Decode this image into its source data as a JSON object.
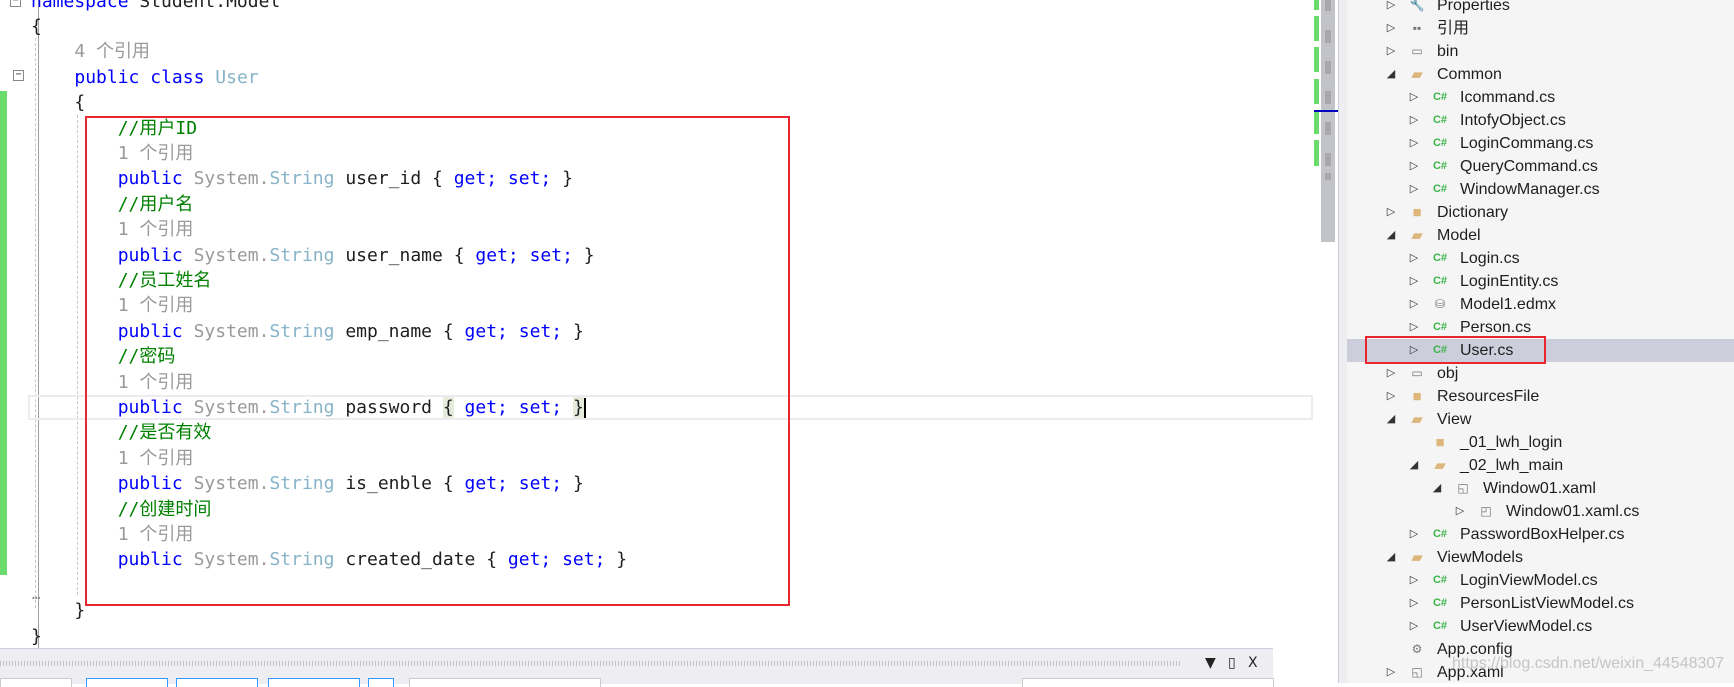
{
  "editor": {
    "lines": [
      [
        {
          "t": "namespace ",
          "k": "kw"
        },
        {
          "t": "Student.Model",
          "k": "id"
        }
      ],
      [
        {
          "t": "{",
          "k": "br"
        }
      ],
      [
        {
          "t": "    "
        },
        {
          "t": "4 个引用",
          "k": "lens"
        }
      ],
      [
        {
          "t": "    "
        },
        {
          "t": "public",
          "k": "kw"
        },
        {
          "t": " "
        },
        {
          "t": "class",
          "k": "kw"
        },
        {
          "t": " "
        },
        {
          "t": "User",
          "k": "ty"
        }
      ],
      [
        {
          "t": "    "
        },
        {
          "t": "{",
          "k": "br"
        }
      ],
      [
        {
          "t": "        "
        },
        {
          "t": "//用户ID",
          "k": "cm"
        }
      ],
      [
        {
          "t": "        "
        },
        {
          "t": "1 个引用",
          "k": "lens"
        }
      ],
      [
        {
          "t": "        "
        },
        {
          "t": "public",
          "k": "kw"
        },
        {
          "t": " "
        },
        {
          "t": "System.",
          "k": "sys"
        },
        {
          "t": "String",
          "k": "ty"
        },
        {
          "t": " "
        },
        {
          "t": "user_id",
          "k": "id"
        },
        {
          "t": " "
        },
        {
          "t": "{",
          "k": "br"
        },
        {
          "t": " "
        },
        {
          "t": "get;",
          "k": "kw"
        },
        {
          "t": " "
        },
        {
          "t": "set;",
          "k": "kw"
        },
        {
          "t": " "
        },
        {
          "t": "}",
          "k": "br"
        }
      ],
      [
        {
          "t": "        "
        },
        {
          "t": "//用户名",
          "k": "cm"
        }
      ],
      [
        {
          "t": "        "
        },
        {
          "t": "1 个引用",
          "k": "lens"
        }
      ],
      [
        {
          "t": "        "
        },
        {
          "t": "public",
          "k": "kw"
        },
        {
          "t": " "
        },
        {
          "t": "System.",
          "k": "sys"
        },
        {
          "t": "String",
          "k": "ty"
        },
        {
          "t": " "
        },
        {
          "t": "user_name",
          "k": "id"
        },
        {
          "t": " "
        },
        {
          "t": "{",
          "k": "br"
        },
        {
          "t": " "
        },
        {
          "t": "get;",
          "k": "kw"
        },
        {
          "t": " "
        },
        {
          "t": "set;",
          "k": "kw"
        },
        {
          "t": " "
        },
        {
          "t": "}",
          "k": "br"
        }
      ],
      [
        {
          "t": "        "
        },
        {
          "t": "//员工姓名",
          "k": "cm"
        }
      ],
      [
        {
          "t": "        "
        },
        {
          "t": "1 个引用",
          "k": "lens"
        }
      ],
      [
        {
          "t": "        "
        },
        {
          "t": "public",
          "k": "kw"
        },
        {
          "t": " "
        },
        {
          "t": "System.",
          "k": "sys"
        },
        {
          "t": "String",
          "k": "ty"
        },
        {
          "t": " "
        },
        {
          "t": "emp_name",
          "k": "id"
        },
        {
          "t": " "
        },
        {
          "t": "{",
          "k": "br"
        },
        {
          "t": " "
        },
        {
          "t": "get;",
          "k": "kw"
        },
        {
          "t": " "
        },
        {
          "t": "set;",
          "k": "kw"
        },
        {
          "t": " "
        },
        {
          "t": "}",
          "k": "br"
        }
      ],
      [
        {
          "t": "        "
        },
        {
          "t": "//密码",
          "k": "cm"
        }
      ],
      [
        {
          "t": "        "
        },
        {
          "t": "1 个引用",
          "k": "lens"
        }
      ],
      [
        {
          "t": "        "
        },
        {
          "t": "public",
          "k": "kw"
        },
        {
          "t": " "
        },
        {
          "t": "System.",
          "k": "sys"
        },
        {
          "t": "String",
          "k": "ty"
        },
        {
          "t": " "
        },
        {
          "t": "password",
          "k": "id"
        },
        {
          "t": " "
        },
        {
          "t": "{",
          "k": "br hl"
        },
        {
          "t": " "
        },
        {
          "t": "get;",
          "k": "kw"
        },
        {
          "t": " "
        },
        {
          "t": "set;",
          "k": "kw"
        },
        {
          "t": " "
        },
        {
          "t": "}",
          "k": "br hl"
        },
        {
          "caret": true
        }
      ],
      [
        {
          "t": "        "
        },
        {
          "t": "//是否有效",
          "k": "cm"
        }
      ],
      [
        {
          "t": "        "
        },
        {
          "t": "1 个引用",
          "k": "lens"
        }
      ],
      [
        {
          "t": "        "
        },
        {
          "t": "public",
          "k": "kw"
        },
        {
          "t": " "
        },
        {
          "t": "System.",
          "k": "sys"
        },
        {
          "t": "String",
          "k": "ty"
        },
        {
          "t": " "
        },
        {
          "t": "is_enble",
          "k": "id"
        },
        {
          "t": " "
        },
        {
          "t": "{",
          "k": "br"
        },
        {
          "t": " "
        },
        {
          "t": "get;",
          "k": "kw"
        },
        {
          "t": " "
        },
        {
          "t": "set;",
          "k": "kw"
        },
        {
          "t": " "
        },
        {
          "t": "}",
          "k": "br"
        }
      ],
      [
        {
          "t": "        "
        },
        {
          "t": "//创建时间",
          "k": "cm"
        }
      ],
      [
        {
          "t": "        "
        },
        {
          "t": "1 个引用",
          "k": "lens"
        }
      ],
      [
        {
          "t": "        "
        },
        {
          "t": "public",
          "k": "kw"
        },
        {
          "t": " "
        },
        {
          "t": "System.",
          "k": "sys"
        },
        {
          "t": "String",
          "k": "ty"
        },
        {
          "t": " "
        },
        {
          "t": "created_date",
          "k": "id"
        },
        {
          "t": " "
        },
        {
          "t": "{",
          "k": "br"
        },
        {
          "t": " "
        },
        {
          "t": "get;",
          "k": "kw"
        },
        {
          "t": " "
        },
        {
          "t": "set;",
          "k": "kw"
        },
        {
          "t": " "
        },
        {
          "t": "}",
          "k": "br"
        }
      ],
      [],
      [
        {
          "t": "    "
        },
        {
          "t": "}",
          "k": "br"
        }
      ],
      [
        {
          "t": "}",
          "k": "br"
        }
      ]
    ],
    "collapsed_marker": "…",
    "annotation_color": "#e8262d"
  },
  "explorer": {
    "items": [
      {
        "label": "Properties",
        "icon": "wrench-icon",
        "depth": 0,
        "expander": "collapsed"
      },
      {
        "label": "引用",
        "icon": "references-icon",
        "depth": 0,
        "expander": "collapsed"
      },
      {
        "label": "bin",
        "icon": "hidden-folder-icon",
        "depth": 0,
        "expander": "collapsed"
      },
      {
        "label": "Common",
        "icon": "folder-open-icon",
        "depth": 0,
        "expander": "expanded"
      },
      {
        "label": "Icommand.cs",
        "icon": "csharp-file-icon",
        "depth": 1,
        "expander": "collapsed"
      },
      {
        "label": "IntofyObject.cs",
        "icon": "csharp-file-icon",
        "depth": 1,
        "expander": "collapsed"
      },
      {
        "label": "LoginCommang.cs",
        "icon": "csharp-file-icon",
        "depth": 1,
        "expander": "collapsed"
      },
      {
        "label": "QueryCommand.cs",
        "icon": "csharp-file-icon",
        "depth": 1,
        "expander": "collapsed"
      },
      {
        "label": "WindowManager.cs",
        "icon": "csharp-file-icon",
        "depth": 1,
        "expander": "collapsed"
      },
      {
        "label": "Dictionary",
        "icon": "folder-icon",
        "depth": 0,
        "expander": "collapsed"
      },
      {
        "label": "Model",
        "icon": "folder-open-icon",
        "depth": 0,
        "expander": "expanded"
      },
      {
        "label": "Login.cs",
        "icon": "csharp-file-icon",
        "depth": 1,
        "expander": "collapsed"
      },
      {
        "label": "LoginEntity.cs",
        "icon": "csharp-file-icon",
        "depth": 1,
        "expander": "collapsed"
      },
      {
        "label": "Model1.edmx",
        "icon": "edmx-icon",
        "depth": 1,
        "expander": "collapsed"
      },
      {
        "label": "Person.cs",
        "icon": "csharp-file-icon",
        "depth": 1,
        "expander": "collapsed"
      },
      {
        "label": "User.cs",
        "icon": "csharp-file-icon",
        "depth": 1,
        "expander": "collapsed",
        "selected": true
      },
      {
        "label": "obj",
        "icon": "hidden-folder-icon",
        "depth": 0,
        "expander": "collapsed"
      },
      {
        "label": "ResourcesFile",
        "icon": "folder-icon",
        "depth": 0,
        "expander": "collapsed"
      },
      {
        "label": "View",
        "icon": "folder-open-icon",
        "depth": 0,
        "expander": "expanded"
      },
      {
        "label": "_01_lwh_login",
        "icon": "folder-icon",
        "depth": 1,
        "expander": "none"
      },
      {
        "label": "_02_lwh_main",
        "icon": "folder-open-icon",
        "depth": 1,
        "expander": "expanded"
      },
      {
        "label": "Window01.xaml",
        "icon": "xaml-file-icon",
        "depth": 2,
        "expander": "expanded"
      },
      {
        "label": "Window01.xaml.cs",
        "icon": "code-behind-icon",
        "depth": 3,
        "expander": "collapsed"
      },
      {
        "label": "PasswordBoxHelper.cs",
        "icon": "csharp-file-icon",
        "depth": 1,
        "expander": "collapsed"
      },
      {
        "label": "ViewModels",
        "icon": "folder-open-icon",
        "depth": 0,
        "expander": "expanded"
      },
      {
        "label": "LoginViewModel.cs",
        "icon": "csharp-file-icon",
        "depth": 1,
        "expander": "collapsed"
      },
      {
        "label": "PersonListViewModel.cs",
        "icon": "csharp-file-icon",
        "depth": 1,
        "expander": "collapsed"
      },
      {
        "label": "UserViewModel.cs",
        "icon": "csharp-file-icon",
        "depth": 1,
        "expander": "collapsed"
      },
      {
        "label": "App.config",
        "icon": "config-file-icon",
        "depth": 0,
        "expander": "none"
      },
      {
        "label": "App.xaml",
        "icon": "xaml-file-icon",
        "depth": 0,
        "expander": "collapsed"
      }
    ]
  },
  "bottom_panel": {
    "dropdown_icon": "▼",
    "maximize_icon": "▯",
    "close_icon": "X"
  },
  "watermark": "https://blog.csdn.net/weixin_44548307"
}
